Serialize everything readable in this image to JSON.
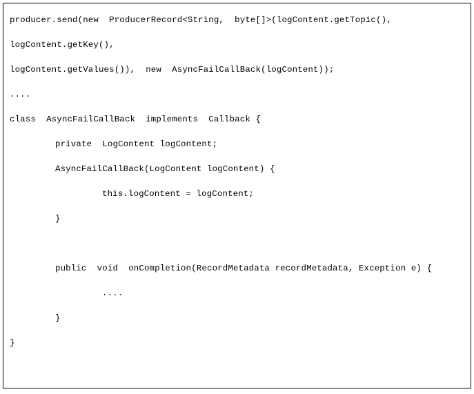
{
  "figure": {
    "kind": "code-listing",
    "language": "Java",
    "border_color": "#000000",
    "background_color": "#ffffff",
    "text_color": "#000000"
  },
  "code": {
    "lines": [
      {
        "text": "producer.send(new  ProducerRecord<String,  byte[]>(logContent.getTopic(),",
        "indent": 0
      },
      {
        "text": "logContent.getKey(),",
        "indent": 0
      },
      {
        "text": "logContent.getValues()),  new  AsyncFailCallBack(logContent));",
        "indent": 0
      },
      {
        "text": "....",
        "indent": 0
      },
      {
        "text": "class  AsyncFailCallBack  implements  Callback {",
        "indent": 0
      },
      {
        "text": "private  LogContent logContent;",
        "indent": 1
      },
      {
        "text": "AsyncFailCallBack(LogContent logContent) {",
        "indent": 1
      },
      {
        "text": "this.logContent = logContent;",
        "indent": 2
      },
      {
        "text": "}",
        "indent": 1
      },
      {
        "text": "",
        "indent": 0
      },
      {
        "text": "public  void  onCompletion(RecordMetadata recordMetadata, Exception e) {",
        "indent": 1
      },
      {
        "text": "....",
        "indent": 2
      },
      {
        "text": "}",
        "indent": 1
      },
      {
        "text": "}",
        "indent": 0
      }
    ]
  }
}
